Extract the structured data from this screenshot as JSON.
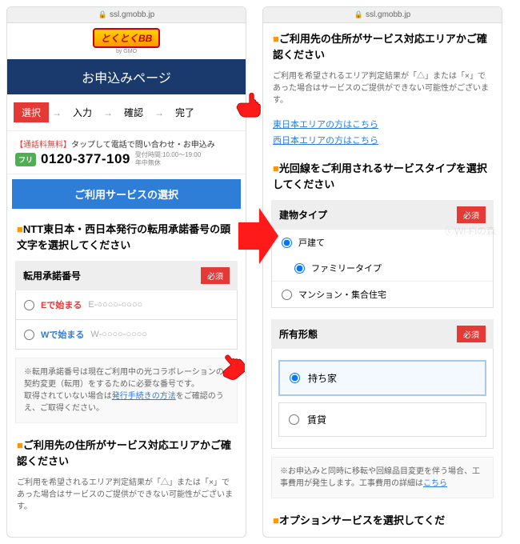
{
  "url": "ssl.gmobb.jp",
  "logo": {
    "main": "とくとくBB",
    "sub": "by GMO"
  },
  "page_title": "お申込みページ",
  "steps": {
    "s1": "選択",
    "s2": "入力",
    "s3": "確認",
    "s4": "完了"
  },
  "tel": {
    "label_free": "【通話料無料】",
    "label_rest": "タップして電話で問い合わせ・お申込み",
    "icon": "フリ",
    "number": "0120-377-109",
    "hours1": "受付時間:10:00～19:00",
    "hours2": "年中無休"
  },
  "sel_header": "ご利用サービスの選択",
  "sec1": {
    "title": "NTT東日本・西日本発行の転用承諾番号の頭文字を選択してください",
    "field": "転用承諾番号",
    "req": "必須",
    "optE_pre": "Eで始まる",
    "optE_code": "E-○○○○-○○○○",
    "optW_pre": "Wで始まる",
    "optW_code": "W-○○○○-○○○○",
    "note_a": "※転用承諾番号は現在ご利用中の光コラボレーションの契約変更（転用）をするために必要な番号です。",
    "note_b": "取得されていない場合は",
    "note_link": "発行手続きの方法",
    "note_c": "をご確認のうえ、ご取得ください。"
  },
  "sec2": {
    "title": "ご利用先の住所がサービス対応エリアかご確認ください",
    "desc": "ご利用を希望されるエリア判定結果が「△」または「×」であった場合はサービスのご提供ができない可能性がございます。",
    "link_e": "東日本エリアの方はこちら",
    "link_w": "西日本エリアの方はこちら"
  },
  "sec3": {
    "title": "光回線をご利用されるサービスタイプを選択してください",
    "field": "建物タイプ",
    "req": "必須",
    "opt1": "戸建て",
    "opt2": "ファミリータイプ",
    "opt3": "マンション・集合住宅"
  },
  "sec4": {
    "field": "所有形態",
    "req": "必須",
    "opt1": "持ち家",
    "opt2": "賃貸",
    "note_a": "※お申込みと同時に移転や回線品目変更を伴う場合、工事費用が発生します。工事費用の詳細は",
    "note_link": "こちら"
  },
  "sec5": {
    "title": "オプションサービスを選択してくだ"
  },
  "watermark": "ⓒWi-Fiの森"
}
